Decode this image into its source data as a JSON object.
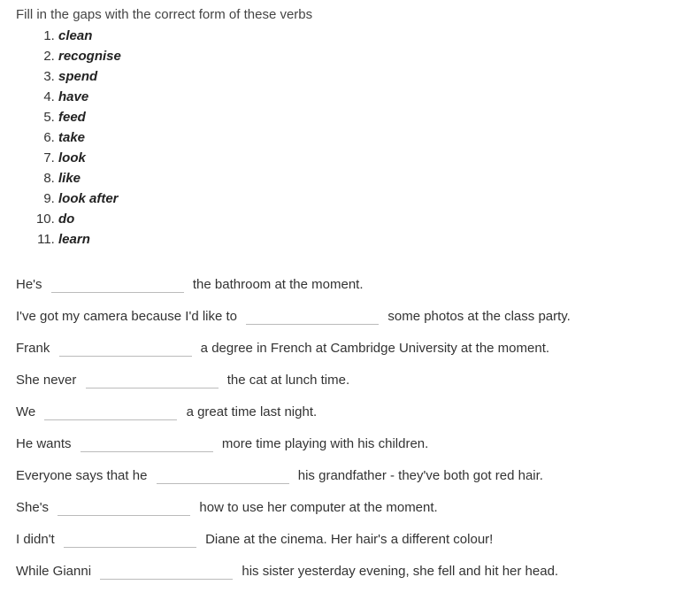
{
  "instruction": "Fill in the gaps with the correct form of these verbs",
  "verbs": {
    "v1": "clean",
    "v2": "recognise",
    "v3": "spend",
    "v4": "have",
    "v5": "feed",
    "v6": "take",
    "v7": "look",
    "v8": "like",
    "v9": "look after",
    "v10": "do",
    "v11": "learn"
  },
  "sentences": {
    "s1a": "He's ",
    "s1b": " the bathroom at the moment.",
    "s2a": "I've got my camera because I'd like to ",
    "s2b": " some photos at the class party.",
    "s3a": "Frank ",
    "s3b": " a degree in French at Cambridge University at the moment.",
    "s4a": "She never ",
    "s4b": " the cat at lunch time.",
    "s5a": "We ",
    "s5b": " a great time last night.",
    "s6a": "He wants ",
    "s6b": " more time playing with his children.",
    "s7a": "Everyone says that he ",
    "s7b": " his grandfather - they've both got red hair.",
    "s8a": "She's ",
    "s8b": " how to use her computer at the moment.",
    "s9a": "I didn't ",
    "s9b": " Diane at the cinema. Her hair's a different colour!",
    "s10a": "While Gianni ",
    "s10b": " his sister yesterday evening, she fell and hit her head."
  }
}
